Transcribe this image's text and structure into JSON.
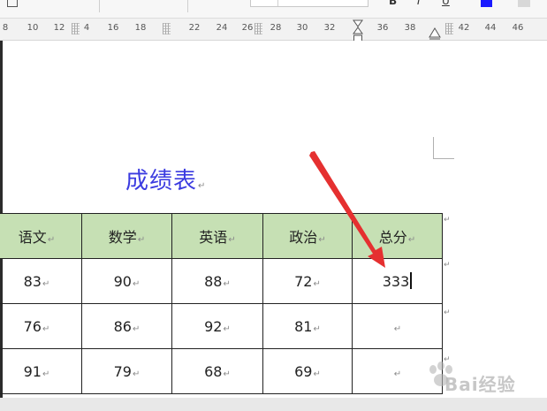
{
  "ruler": {
    "numbers": [
      "8",
      "10",
      "12",
      "4",
      "16",
      "18",
      "22",
      "24",
      "26",
      "28",
      "30",
      "32",
      "36",
      "38",
      "42",
      "44",
      "46"
    ]
  },
  "document": {
    "title": "成绩表",
    "paragraph_mark": "↵",
    "table": {
      "headers": [
        "语文",
        "数学",
        "英语",
        "政治",
        "总分"
      ],
      "rows": [
        [
          "83",
          "90",
          "88",
          "72",
          "333"
        ],
        [
          "76",
          "86",
          "92",
          "81",
          ""
        ],
        [
          "91",
          "79",
          "68",
          "69",
          ""
        ]
      ]
    }
  },
  "watermark": {
    "text": "Bai经验"
  },
  "colors": {
    "title": "#3b3be0",
    "header_fill": "#c6e0b4",
    "arrow": "#e53030",
    "font_color_swatch": "#1a1aff"
  }
}
